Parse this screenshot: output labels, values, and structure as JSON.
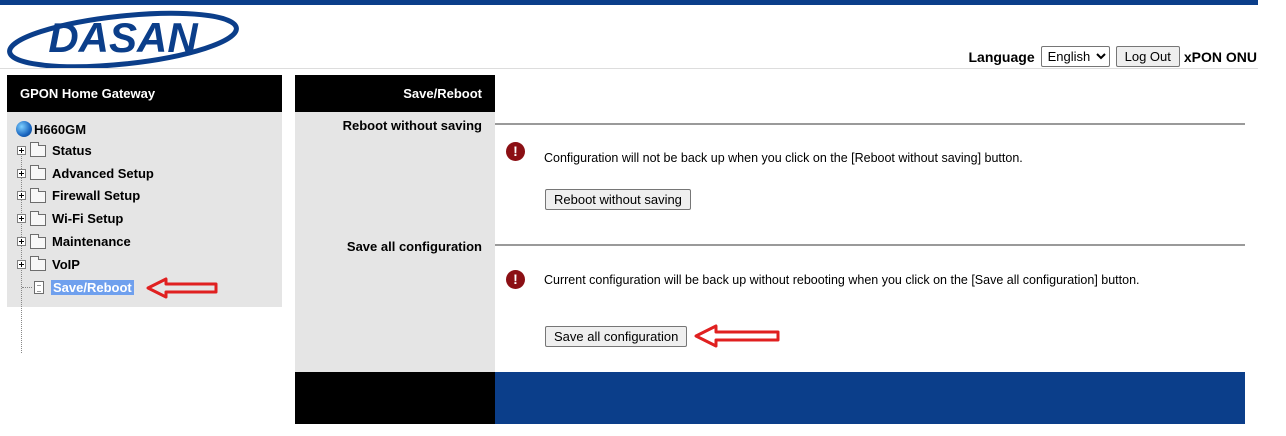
{
  "brand": {
    "logo_text": "DASAN",
    "color": "#0b3e8a"
  },
  "header": {
    "language_label": "Language",
    "language_value": "English",
    "logout_label": "Log Out",
    "product": "xPON ONU"
  },
  "sidebar": {
    "title": "GPON Home Gateway",
    "root": "H660GM",
    "items": [
      {
        "label": "Status"
      },
      {
        "label": "Advanced Setup"
      },
      {
        "label": "Firewall Setup"
      },
      {
        "label": "Wi-Fi Setup"
      },
      {
        "label": "Maintenance"
      },
      {
        "label": "VoIP"
      }
    ],
    "selected": "Save/Reboot"
  },
  "main": {
    "title": "Save/Reboot",
    "sections": [
      {
        "label": "Reboot without saving",
        "message": "Configuration will not be back up when you click on the [Reboot without saving] button.",
        "button": "Reboot without saving"
      },
      {
        "label": "Save all configuration",
        "message": "Current configuration will be back up without rebooting when you click on the [Save all configuration] button.",
        "button": "Save all configuration"
      }
    ]
  },
  "colors": {
    "accent": "#0b3e8a",
    "warning": "#8b0f14",
    "annotation": "#e02020"
  }
}
